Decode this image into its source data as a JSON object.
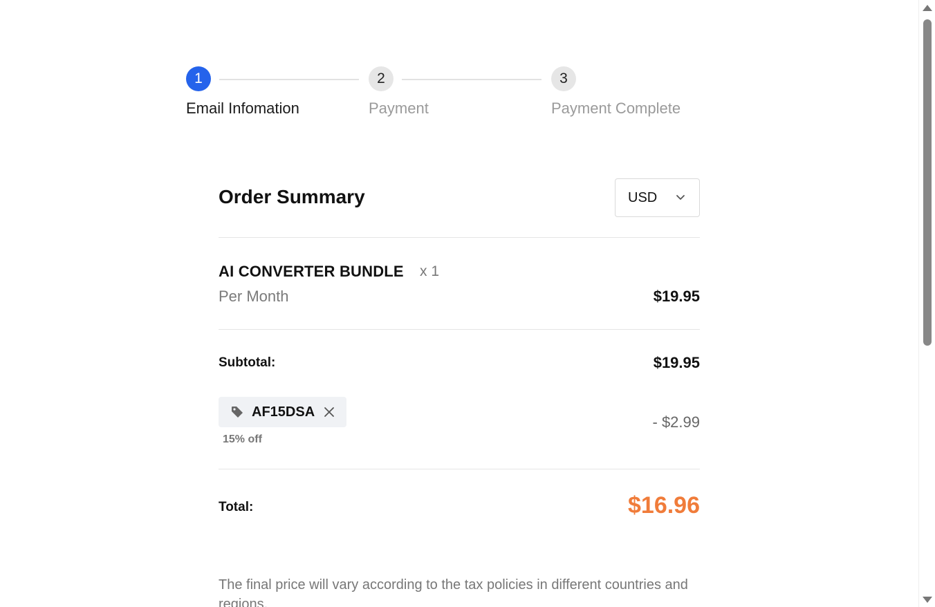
{
  "stepper": {
    "steps": [
      {
        "number": "1",
        "label": "Email Infomation",
        "active": true
      },
      {
        "number": "2",
        "label": "Payment",
        "active": false
      },
      {
        "number": "3",
        "label": "Payment Complete",
        "active": false
      }
    ]
  },
  "summary": {
    "title": "Order Summary",
    "currency": "USD",
    "product": {
      "name": "AI CONVERTER BUNDLE",
      "quantity": "x 1",
      "period": "Per Month",
      "price": "$19.95"
    },
    "subtotal_label": "Subtotal:",
    "subtotal_value": "$19.95",
    "coupon": {
      "code": "AF15DSA",
      "description": "15% off",
      "discount": "- $2.99"
    },
    "total_label": "Total:",
    "total_value": "$16.96"
  },
  "tax_note": "The final price will vary according to the tax policies in different countries and regions.",
  "colors": {
    "active_step": "#2563eb",
    "total_accent": "#f07c3a"
  },
  "icons": {
    "coupon": "tag-icon",
    "remove": "close-icon",
    "dropdown": "chevron-down-icon"
  }
}
